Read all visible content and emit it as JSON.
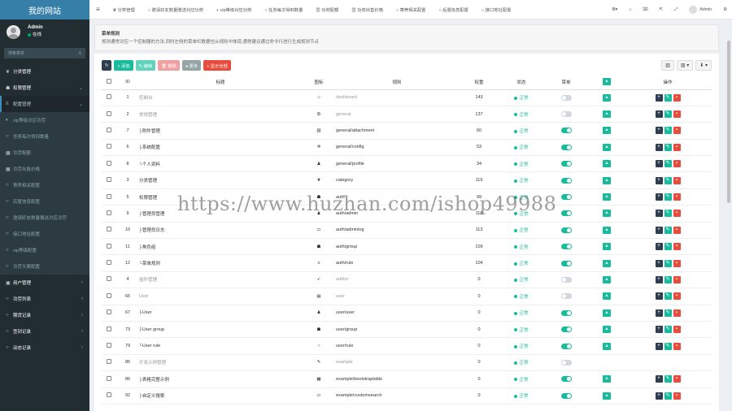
{
  "sidebar": {
    "logo": "我的网站",
    "user": {
      "name": "Admin",
      "status": "在线",
      "status_color": "#00a65a"
    },
    "search_placeholder": "搜索菜单",
    "items": [
      {
        "icon": "leaf-icon",
        "glyph": "❦",
        "label": "分类管理",
        "kind": "main",
        "arrow": ""
      },
      {
        "icon": "users-icon",
        "glyph": "☗",
        "label": "权限管理",
        "kind": "main",
        "arrow": "⌄"
      },
      {
        "icon": "cogs-icon",
        "glyph": "≡",
        "label": "配置管理",
        "kind": "active",
        "arrow": "⌄"
      },
      {
        "icon": "circle-icon",
        "glyph": "◐",
        "label": "vip等级对应功劳",
        "kind": "sub",
        "arrow": ""
      },
      {
        "icon": "circle-icon",
        "glyph": "○",
        "label": "任务每次得到数量",
        "kind": "sub",
        "arrow": ""
      },
      {
        "icon": "chart-icon",
        "glyph": "▦",
        "label": "功劳配额",
        "kind": "sub",
        "arrow": ""
      },
      {
        "icon": "chart-icon",
        "glyph": "▦",
        "label": "功劳出售价格",
        "kind": "sub",
        "arrow": ""
      },
      {
        "icon": "circle-icon",
        "glyph": "○",
        "label": "寄养相关配置",
        "kind": "sub",
        "arrow": ""
      },
      {
        "icon": "circle-icon",
        "glyph": "○",
        "label": "后置信息配置",
        "kind": "sub",
        "arrow": ""
      },
      {
        "icon": "circle-icon",
        "glyph": "○",
        "label": "邀请好友数量赠送对应功劳",
        "kind": "sub",
        "arrow": ""
      },
      {
        "icon": "circle-icon",
        "glyph": "○",
        "label": "接口地址配置",
        "kind": "sub",
        "arrow": ""
      },
      {
        "icon": "circle-icon",
        "glyph": "○",
        "label": "vip等级配置",
        "kind": "sub",
        "arrow": ""
      },
      {
        "icon": "circle-icon",
        "glyph": "○",
        "label": "功劳文案配置",
        "kind": "sub",
        "arrow": ""
      },
      {
        "icon": "user-icon",
        "glyph": "▣",
        "label": "用户管理",
        "kind": "main",
        "arrow": "‹"
      },
      {
        "icon": "circle-icon",
        "glyph": "○",
        "label": "功劳列表",
        "kind": "main",
        "arrow": "‹"
      },
      {
        "icon": "circle-icon",
        "glyph": "○",
        "label": "期货记录",
        "kind": "main",
        "arrow": "‹"
      },
      {
        "icon": "circle-icon",
        "glyph": "○",
        "label": "签到记录",
        "kind": "main",
        "arrow": "‹"
      },
      {
        "icon": "circle-icon",
        "glyph": "○",
        "label": "动态记录",
        "kind": "main",
        "arrow": "‹"
      }
    ]
  },
  "topbar": {
    "menu_icon": "≡",
    "tabs": [
      {
        "glyph": "❦",
        "label": "分类管理"
      },
      {
        "glyph": "○",
        "label": "邀请好友数量赠送对应功劳"
      },
      {
        "glyph": "◐",
        "label": "vip等级对应功劳"
      },
      {
        "glyph": "○",
        "label": "任务每次得到数量"
      },
      {
        "glyph": "▦",
        "label": "功劳配额"
      },
      {
        "glyph": "▦",
        "label": "功劳出售价格"
      },
      {
        "glyph": "○",
        "label": "寄养相关配置"
      },
      {
        "glyph": "○",
        "label": "后置信息配置"
      },
      {
        "glyph": "○",
        "label": "接口地址配置"
      }
    ],
    "right_icons": [
      "≣▾",
      "⌂",
      "⌧",
      "⇱",
      "⤢"
    ],
    "admin_label": "Admin",
    "settings_icon": "⚙"
  },
  "page_header": {
    "title": "菜单规则",
    "description": "规则通常对应一个控制器的方法,同时左侧的菜单栏数据也从规则中体现,通常建议通过命令行进行生成规则节点"
  },
  "toolbar": {
    "refresh": "↻",
    "add": "+ 添加",
    "edit": "✎ 编辑",
    "delete": "🗑 删除",
    "more": "● 更多",
    "expand": "+ 显示全部",
    "colors": {
      "refresh": "#2c3e50",
      "add": "#18bc9c",
      "edit": "#5fd3bc",
      "delete": "#f0a0a0",
      "more": "#95a5a6",
      "expand": "#e74c3c"
    },
    "right_tools": [
      "▥",
      "▥ ▾",
      "⬇ ▾"
    ]
  },
  "table": {
    "headers": [
      "",
      "ID",
      "标题",
      "图标",
      "规则",
      "权重",
      "状态",
      "菜单",
      "",
      "操作"
    ],
    "rows": [
      {
        "id": "1",
        "title": "控制台",
        "icon": "⌂",
        "rule": "dashboard",
        "weight": "143",
        "status": "正常",
        "menu": "off",
        "grey": true,
        "ops": true
      },
      {
        "id": "2",
        "title": "常规管理",
        "icon": "⚙",
        "rule": "general",
        "weight": "137",
        "status": "正常",
        "menu": "off",
        "grey": true,
        "ops": true
      },
      {
        "id": "7",
        "title": "├附件管理",
        "icon": "▨",
        "rule": "general/attachment",
        "weight": "60",
        "status": "正常",
        "menu": "on",
        "grey": false,
        "ops": true
      },
      {
        "id": "6",
        "title": "├系统配置",
        "icon": "✲",
        "rule": "general/config",
        "weight": "53",
        "status": "正常",
        "menu": "on",
        "grey": false,
        "ops": true
      },
      {
        "id": "8",
        "title": "└个人资料",
        "icon": "♟",
        "rule": "general/profile",
        "weight": "34",
        "status": "正常",
        "menu": "on",
        "grey": false,
        "ops": true
      },
      {
        "id": "3",
        "title": "分类管理",
        "icon": "❦",
        "rule": "category",
        "weight": "119",
        "status": "正常",
        "menu": "on",
        "grey": false,
        "ops": true
      },
      {
        "id": "5",
        "title": "权限管理",
        "icon": "☗",
        "rule": "auth",
        "weight": "99",
        "status": "正常",
        "menu": "on",
        "grey": false,
        "ops": true
      },
      {
        "id": "9",
        "title": "├管理员管理",
        "icon": "♟",
        "rule": "auth/admin",
        "weight": "118",
        "status": "正常",
        "menu": "on",
        "grey": false,
        "ops": true
      },
      {
        "id": "10",
        "title": "├管理员日志",
        "icon": "▭",
        "rule": "auth/adminlog",
        "weight": "113",
        "status": "正常",
        "menu": "on",
        "grey": false,
        "ops": true
      },
      {
        "id": "11",
        "title": "├角色组",
        "icon": "☗",
        "rule": "auth/group",
        "weight": "109",
        "status": "正常",
        "menu": "on",
        "grey": false,
        "ops": true
      },
      {
        "id": "12",
        "title": "└菜单规则",
        "icon": "≡",
        "rule": "auth/rule",
        "weight": "104",
        "status": "正常",
        "menu": "on",
        "grey": false,
        "ops": true
      },
      {
        "id": "4",
        "title": "插件管理",
        "icon": "➶",
        "rule": "addon",
        "weight": "0",
        "status": "正常",
        "menu": "off",
        "grey": true,
        "ops": true
      },
      {
        "id": "66",
        "title": "User",
        "icon": "▤",
        "rule": "user",
        "weight": "0",
        "status": "正常",
        "menu": "off",
        "grey": true,
        "ops": true
      },
      {
        "id": "67",
        "title": "├User",
        "icon": "♟",
        "rule": "user/user",
        "weight": "0",
        "status": "正常",
        "menu": "on",
        "grey": false,
        "ops": true
      },
      {
        "id": "73",
        "title": "├User group",
        "icon": "☗",
        "rule": "user/group",
        "weight": "0",
        "status": "正常",
        "menu": "on",
        "grey": false,
        "ops": true
      },
      {
        "id": "79",
        "title": "└User rule",
        "icon": "○",
        "rule": "user/rule",
        "weight": "0",
        "status": "正常",
        "menu": "on",
        "grey": false,
        "ops": true
      },
      {
        "id": "85",
        "title": "开发示例管理",
        "icon": "✎",
        "rule": "example",
        "weight": "0",
        "status": "正常",
        "menu": "off",
        "grey": true,
        "ops": false
      },
      {
        "id": "86",
        "title": "├表格完整示例",
        "icon": "▦",
        "rule": "example/bootstraptable",
        "weight": "0",
        "status": "正常",
        "menu": "on",
        "grey": false,
        "ops": true
      },
      {
        "id": "92",
        "title": "├自定义搜索",
        "icon": "▭",
        "rule": "example/customsearch",
        "weight": "0",
        "status": "正常",
        "menu": "on",
        "grey": false,
        "ops": true
      }
    ]
  },
  "watermark": "https://www.huzhan.com/ishop49988"
}
